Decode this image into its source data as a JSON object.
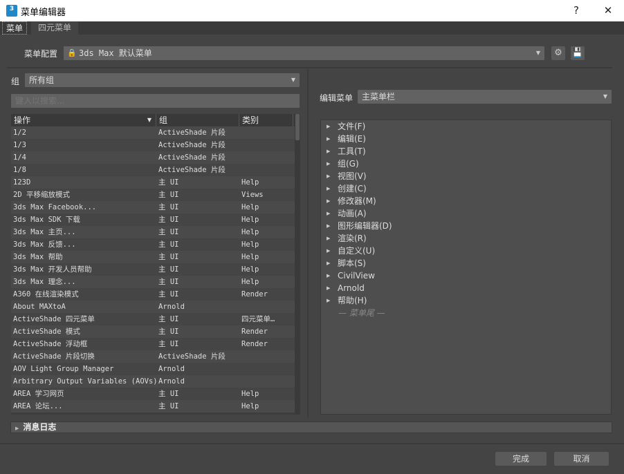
{
  "window": {
    "title": "菜单编辑器",
    "app_icon_text": "3",
    "help": "?",
    "close": "✕"
  },
  "tabs": [
    {
      "label": "菜单"
    },
    {
      "label": "四元菜单"
    }
  ],
  "config": {
    "label": "菜单配置",
    "value": "3ds Max 默认菜单",
    "lock_icon": "lock-icon",
    "gear_icon": "gear-icon",
    "save_icon": "save-icon"
  },
  "left": {
    "group_label": "组",
    "group_value": "所有组",
    "search_placeholder": "键入以搜索...",
    "columns": [
      "操作",
      "组",
      "类别"
    ],
    "rows": [
      [
        "1/2",
        "ActiveShade 片段",
        ""
      ],
      [
        "1/3",
        "ActiveShade 片段",
        ""
      ],
      [
        "1/4",
        "ActiveShade 片段",
        ""
      ],
      [
        "1/8",
        "ActiveShade 片段",
        ""
      ],
      [
        "123D",
        "主 UI",
        "Help"
      ],
      [
        "2D 平移缩放模式",
        "主 UI",
        "Views"
      ],
      [
        "3ds Max Facebook...",
        "主 UI",
        "Help"
      ],
      [
        "3ds Max SDK 下载",
        "主 UI",
        "Help"
      ],
      [
        "3ds Max 主页...",
        "主 UI",
        "Help"
      ],
      [
        "3ds Max 反馈...",
        "主 UI",
        "Help"
      ],
      [
        "3ds Max 帮助",
        "主 UI",
        "Help"
      ],
      [
        "3ds Max 开发人员帮助",
        "主 UI",
        "Help"
      ],
      [
        "3ds Max 理念...",
        "主 UI",
        "Help"
      ],
      [
        "A360 在线渲染模式",
        "主 UI",
        "Render"
      ],
      [
        "About MAXtoA",
        "Arnold",
        ""
      ],
      [
        "ActiveShade 四元菜单",
        "主 UI",
        "四元菜单…"
      ],
      [
        "ActiveShade 模式",
        "主 UI",
        "Render"
      ],
      [
        "ActiveShade 浮动框",
        "主 UI",
        "Render"
      ],
      [
        "ActiveShade 片段切换",
        "ActiveShade 片段",
        ""
      ],
      [
        "AOV Light Group Manager",
        "Arnold",
        ""
      ],
      [
        "Arbitrary Output Variables (AOVs)",
        "Arnold",
        ""
      ],
      [
        "AREA 学习网页",
        "主 UI",
        "Help"
      ],
      [
        "AREA 论坛...",
        "主 UI",
        "Help"
      ]
    ]
  },
  "right": {
    "edit_label": "编辑菜单",
    "edit_value": "主菜单栏",
    "items": [
      "文件(F)",
      "编辑(E)",
      "工具(T)",
      "组(G)",
      "视图(V)",
      "创建(C)",
      "修改器(M)",
      "动画(A)",
      "图形编辑器(D)",
      "渲染(R)",
      "自定义(U)",
      "脚本(S)",
      "CivilView",
      "Arnold",
      "帮助(H)"
    ],
    "end_marker": "— 菜单尾 —"
  },
  "log": {
    "label": "消息日志"
  },
  "footer": {
    "done": "完成",
    "cancel": "取消"
  }
}
